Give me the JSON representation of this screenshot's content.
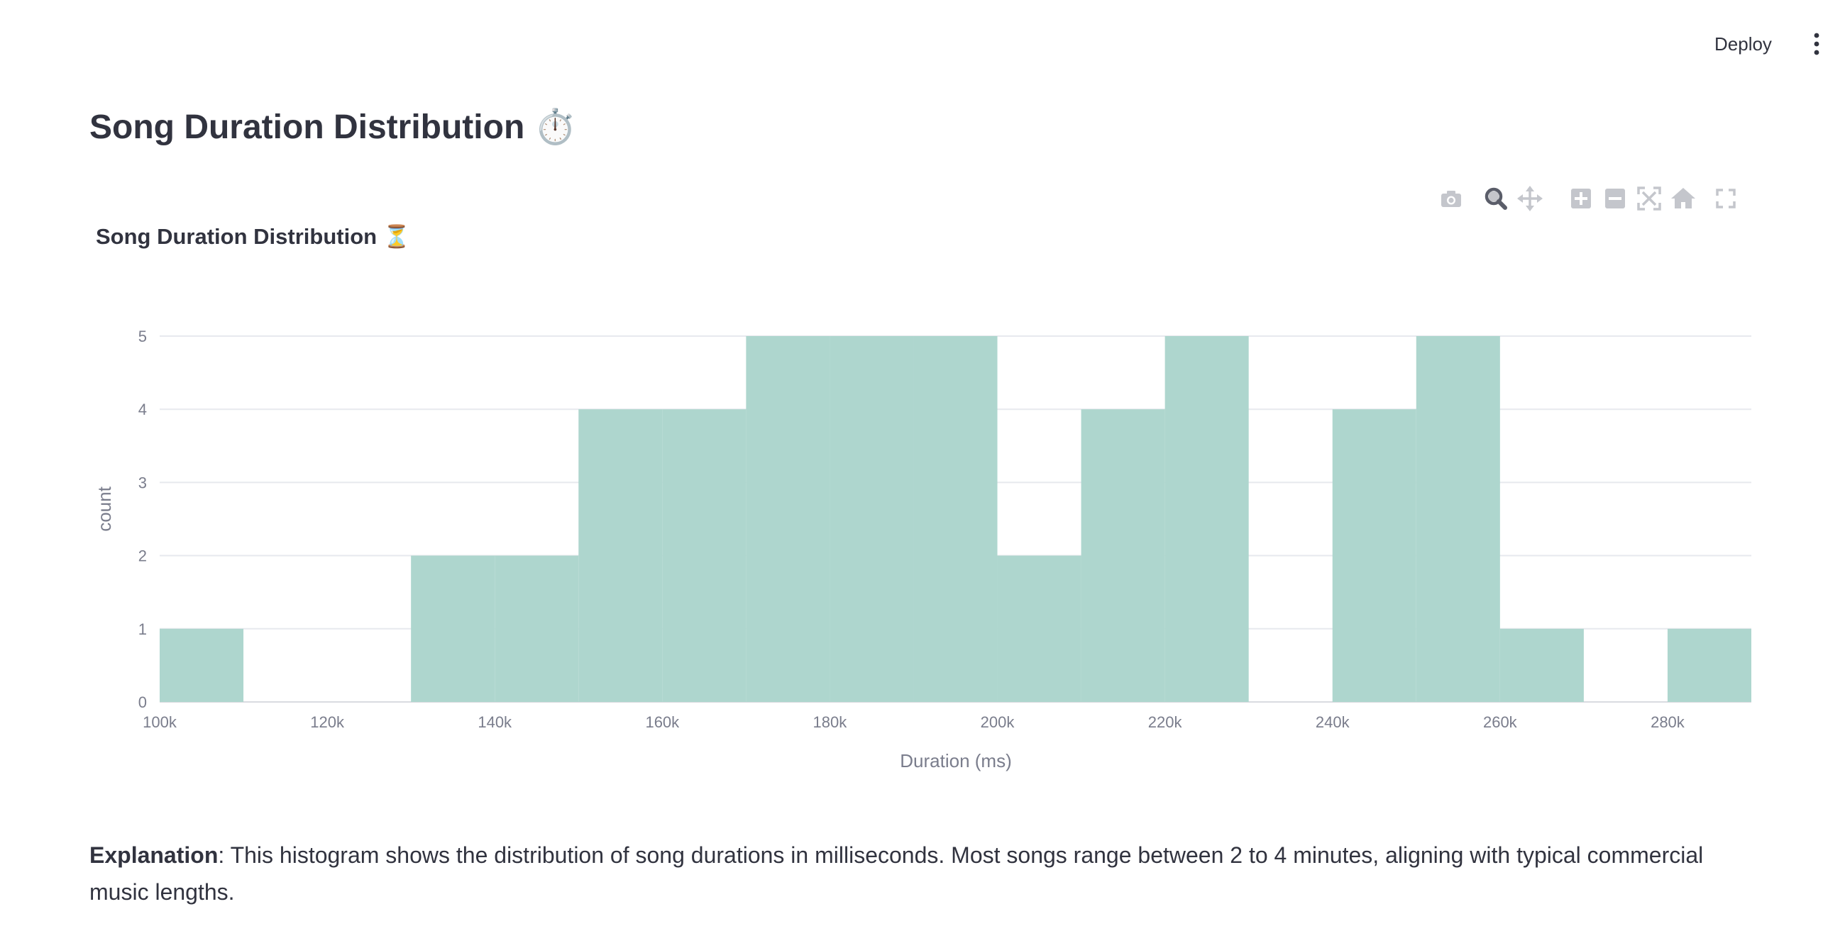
{
  "header": {
    "deploy_label": "Deploy",
    "menu_icon": "kebab-menu-icon"
  },
  "page": {
    "title": "Song Duration Distribution",
    "title_icon": "⏱️"
  },
  "modebar": {
    "icons": [
      "camera-icon",
      "zoom-icon",
      "pan-icon",
      "zoom-in-icon",
      "zoom-out-icon",
      "autoscale-icon",
      "reset-axes-icon",
      "fullscreen-icon"
    ]
  },
  "explanation": {
    "label": "Explanation",
    "text": ": This histogram shows the distribution of song durations in milliseconds. Most songs range between 2 to 4 minutes, aligning with typical commercial music lengths."
  },
  "colors": {
    "bar": "#aed6ce",
    "grid": "#e7e9ee",
    "axis_text": "#7a7d8c",
    "title_text": "#31333f"
  },
  "chart_data": {
    "type": "bar",
    "title": "Song Duration Distribution ⏳",
    "xlabel": "Duration (ms)",
    "ylabel": "count",
    "bin_size": 10000,
    "bins": [
      {
        "start": 100000,
        "end": 110000,
        "count": 1
      },
      {
        "start": 110000,
        "end": 120000,
        "count": 0
      },
      {
        "start": 120000,
        "end": 130000,
        "count": 0
      },
      {
        "start": 130000,
        "end": 140000,
        "count": 2
      },
      {
        "start": 140000,
        "end": 150000,
        "count": 2
      },
      {
        "start": 150000,
        "end": 160000,
        "count": 4
      },
      {
        "start": 160000,
        "end": 170000,
        "count": 4
      },
      {
        "start": 170000,
        "end": 180000,
        "count": 5
      },
      {
        "start": 180000,
        "end": 190000,
        "count": 5
      },
      {
        "start": 190000,
        "end": 200000,
        "count": 5
      },
      {
        "start": 200000,
        "end": 210000,
        "count": 2
      },
      {
        "start": 210000,
        "end": 220000,
        "count": 4
      },
      {
        "start": 220000,
        "end": 230000,
        "count": 5
      },
      {
        "start": 230000,
        "end": 240000,
        "count": 0
      },
      {
        "start": 240000,
        "end": 250000,
        "count": 4
      },
      {
        "start": 250000,
        "end": 260000,
        "count": 5
      },
      {
        "start": 260000,
        "end": 270000,
        "count": 1
      },
      {
        "start": 270000,
        "end": 280000,
        "count": 0
      },
      {
        "start": 280000,
        "end": 290000,
        "count": 1
      }
    ],
    "xlim": [
      100000,
      290000
    ],
    "ylim": [
      0,
      5
    ],
    "x_ticks": [
      100000,
      120000,
      140000,
      160000,
      180000,
      200000,
      220000,
      240000,
      260000,
      280000
    ],
    "x_tick_labels": [
      "100k",
      "120k",
      "140k",
      "160k",
      "180k",
      "200k",
      "220k",
      "240k",
      "260k",
      "280k"
    ],
    "y_ticks": [
      0,
      1,
      2,
      3,
      4,
      5
    ],
    "y_tick_labels": [
      "0",
      "1",
      "2",
      "3",
      "4",
      "5"
    ],
    "grid": true,
    "legend": "none"
  }
}
